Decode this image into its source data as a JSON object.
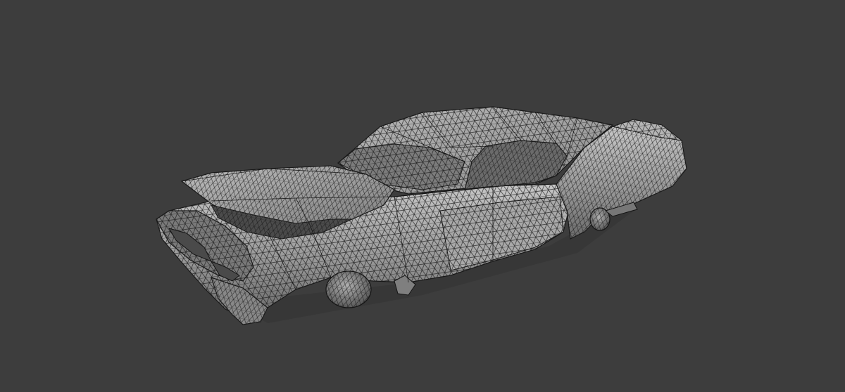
{
  "viewport": {
    "background_color": "#3d3d3d",
    "mesh_fill_color": "#8e8e8e",
    "mesh_highlight_color": "#c9c9c9",
    "mesh_shadow_color": "#5e5e5e",
    "wireframe_color": "#141414"
  },
  "model": {
    "subject": "car",
    "display_mode": "wireframe-on-shaded"
  }
}
